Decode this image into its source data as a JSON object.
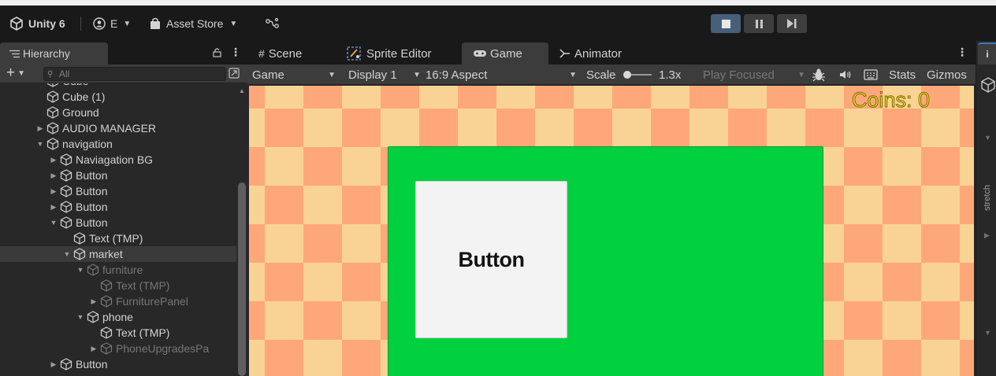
{
  "toolbar": {
    "unity_label": "Unity 6",
    "account_label": "E",
    "asset_store_label": "Asset Store"
  },
  "hierarchy": {
    "tab_label": "Hierarchy",
    "search_placeholder": "All",
    "items": [
      {
        "label": "Cube",
        "indent": 1,
        "arrow": "",
        "state": "normal"
      },
      {
        "label": "Cube (1)",
        "indent": 1,
        "arrow": "",
        "state": "normal"
      },
      {
        "label": "Ground",
        "indent": 1,
        "arrow": "",
        "state": "normal"
      },
      {
        "label": "AUDIO MANAGER",
        "indent": 1,
        "arrow": "right",
        "state": "normal"
      },
      {
        "label": "navigation",
        "indent": 1,
        "arrow": "down",
        "state": "normal"
      },
      {
        "label": "Naviagation BG",
        "indent": 2,
        "arrow": "right",
        "state": "normal"
      },
      {
        "label": "Button",
        "indent": 2,
        "arrow": "right",
        "state": "normal"
      },
      {
        "label": "Button",
        "indent": 2,
        "arrow": "right",
        "state": "normal"
      },
      {
        "label": "Button",
        "indent": 2,
        "arrow": "right",
        "state": "normal"
      },
      {
        "label": "Button",
        "indent": 2,
        "arrow": "down",
        "state": "normal"
      },
      {
        "label": "Text (TMP)",
        "indent": 3,
        "arrow": "",
        "state": "normal"
      },
      {
        "label": "market",
        "indent": 3,
        "arrow": "down",
        "state": "selected"
      },
      {
        "label": "furniture",
        "indent": 4,
        "arrow": "down",
        "state": "dim"
      },
      {
        "label": "Text (TMP)",
        "indent": 5,
        "arrow": "",
        "state": "dim"
      },
      {
        "label": "FurniturePanel",
        "indent": 5,
        "arrow": "right",
        "state": "dim"
      },
      {
        "label": "phone",
        "indent": 4,
        "arrow": "down",
        "state": "normal"
      },
      {
        "label": "Text (TMP)",
        "indent": 5,
        "arrow": "",
        "state": "normal"
      },
      {
        "label": "PhoneUpgradesPa",
        "indent": 5,
        "arrow": "right",
        "state": "dim"
      },
      {
        "label": "Button",
        "indent": 2,
        "arrow": "right",
        "state": "normal"
      }
    ]
  },
  "tabs": {
    "scene": "Scene",
    "sprite_editor": "Sprite Editor",
    "game": "Game",
    "animator": "Animator"
  },
  "game_controls": {
    "mode": "Game",
    "display": "Display 1",
    "aspect": "16:9 Aspect",
    "scale_label": "Scale",
    "scale_value": "1.3x",
    "play_focused": "Play Focused",
    "stats": "Stats",
    "gizmos": "Gizmos"
  },
  "game_view": {
    "coins_text": "Coins: 0",
    "button_text": "Button",
    "panel_color": "#01d03f",
    "checker_colors": [
      "#f9d394",
      "#fea879"
    ]
  },
  "inspector": {
    "stretch_label": "stretch"
  }
}
